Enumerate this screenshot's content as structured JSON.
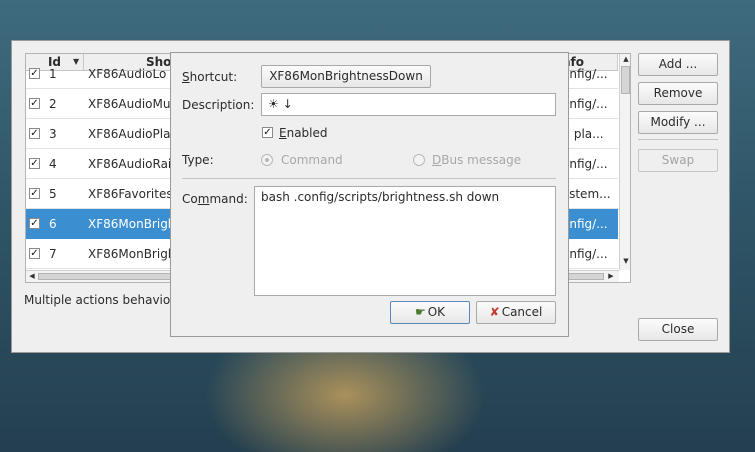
{
  "table": {
    "col_id": "Id",
    "col_shortcut": "Sho",
    "col_info": "nfo",
    "rows": [
      {
        "id": "1",
        "shortcut": "XF86AudioLo",
        "info": "onfig/...",
        "checked": "✓",
        "selected": false
      },
      {
        "id": "2",
        "shortcut": "XF86AudioMu",
        "info": "onfig/...",
        "checked": "✓",
        "selected": false
      },
      {
        "id": "3",
        "shortcut": "XF86AudioPla",
        "info": "tl pla...",
        "checked": "✓",
        "selected": false
      },
      {
        "id": "4",
        "shortcut": "XF86AudioRai",
        "info": "onfig/...",
        "checked": "✓",
        "selected": false
      },
      {
        "id": "5",
        "shortcut": "XF86Favorites",
        "info": "ystem...",
        "checked": "✓",
        "selected": false
      },
      {
        "id": "6",
        "shortcut": "XF86MonBrigh",
        "info": "onfig/...",
        "checked": "✓",
        "selected": true
      },
      {
        "id": "7",
        "shortcut": "XF86MonBrigl",
        "info": "onfig/...",
        "checked": "✓",
        "selected": false
      }
    ]
  },
  "side_buttons": {
    "add": "Add ...",
    "remove": "Remove",
    "modify": "Modify ...",
    "swap": "Swap",
    "close": "Close"
  },
  "status_text": "Multiple actions behavio",
  "dialog": {
    "shortcut_label_u": "S",
    "shortcut_label_rest": "hortcut:",
    "shortcut_value": "XF86MonBrightnessDown",
    "description_label": "Description:",
    "description_value": "☀ ↓",
    "enabled_check": "✓",
    "enabled_label_u": "E",
    "enabled_label_rest": "nabled",
    "type_label": "Type:",
    "type_command": "Command",
    "type_dbus_u": "D",
    "type_dbus_rest": "Bus message",
    "command_label_a": "Co",
    "command_label_u": "m",
    "command_label_b": "mand:",
    "command_value": "bash .config/scripts/brightness.sh down",
    "ok_label": "OK",
    "cancel_label": "Cancel"
  },
  "icons": {
    "ok": "ok-hand-icon",
    "cancel": "cancel-x-icon"
  },
  "colors": {
    "selection": "#3b8fd1",
    "cancel_icon": "#c0392b",
    "ok_icon": "#4a7a2c"
  }
}
